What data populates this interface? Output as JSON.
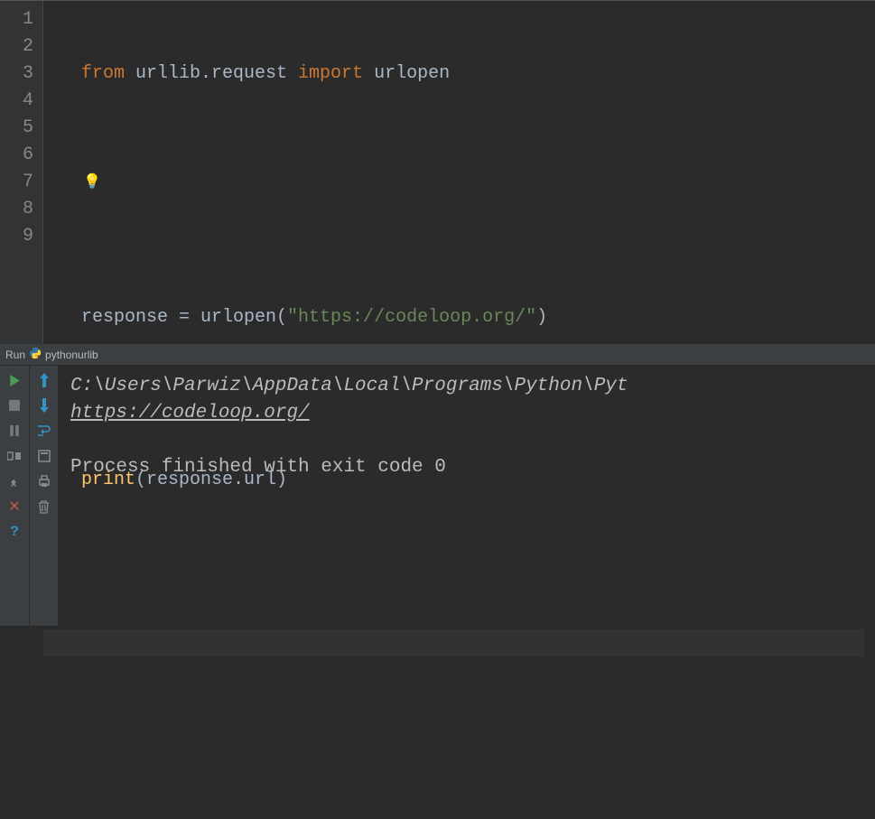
{
  "editor": {
    "line_numbers": [
      "1",
      "2",
      "3",
      "4",
      "5",
      "6",
      "7",
      "8",
      "9"
    ],
    "code": {
      "l1_from": "from",
      "l1_mod": " urllib.request ",
      "l1_import": "import",
      "l1_name": " urlopen",
      "l4_a": "response = urlopen(",
      "l4_str": "\"https://codeloop.org/\"",
      "l4_b": ")",
      "l6_fn": "print",
      "l6_args": "(response.url)"
    }
  },
  "run_header": {
    "label": "Run",
    "config": "pythonurlib"
  },
  "console": {
    "cmd": "C:\\Users\\Parwiz\\AppData\\Local\\Programs\\Python\\Pyt",
    "output_url": "https://codeloop.org/",
    "exit_line": "Process finished with exit code 0"
  },
  "icons": {
    "bulb": "💡"
  }
}
